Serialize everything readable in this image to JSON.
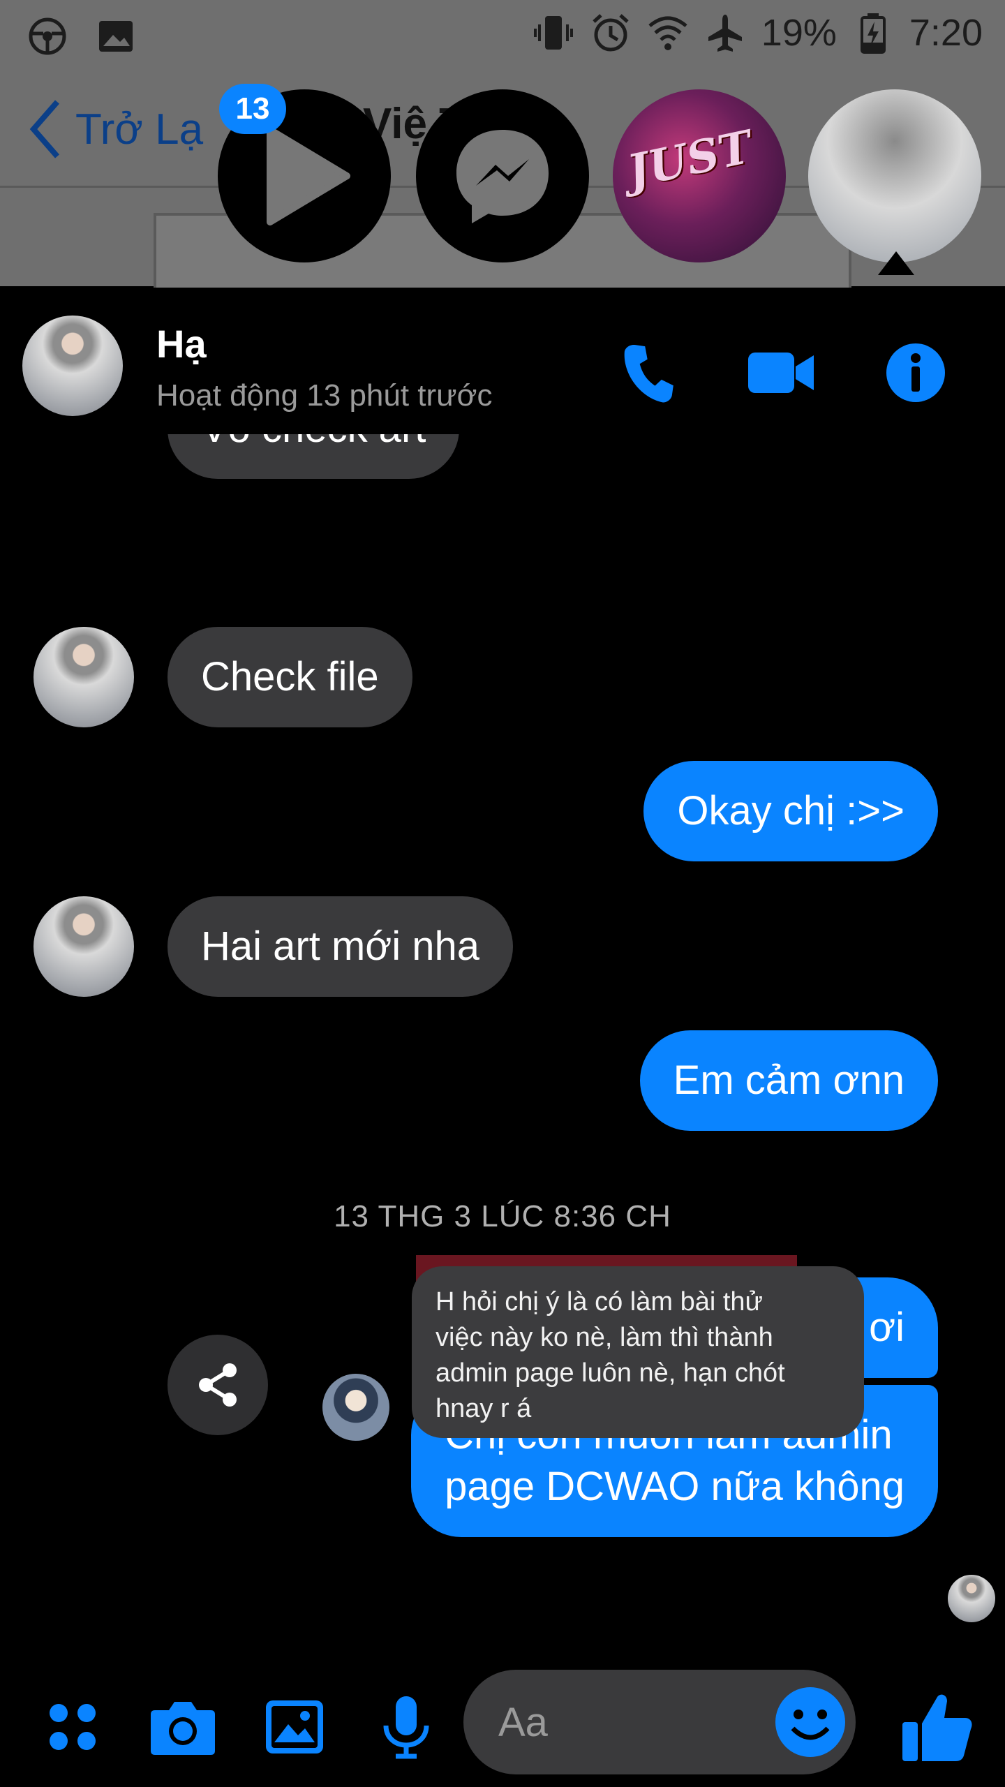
{
  "status_bar": {
    "battery": "19%",
    "time": "7:20",
    "icons": [
      "steering-wheel-icon",
      "image-icon",
      "vibrate-icon",
      "alarm-icon",
      "wifi-icon",
      "airplane-icon",
      "battery-charging-icon"
    ]
  },
  "background_app": {
    "back_label": "Trở Lạ",
    "title_partial": "Việ     Tôi"
  },
  "chat_heads": {
    "badge_count": "13",
    "cover_text": "JUST"
  },
  "chat": {
    "name": "Hạ",
    "status": "Hoạt động 13 phút trước",
    "messages": [
      {
        "side": "in",
        "text": "Vô check art"
      },
      {
        "side": "in",
        "text": "Check file"
      },
      {
        "side": "out",
        "text": "Okay chị :>>"
      },
      {
        "side": "in",
        "text": "Hai art mới nha"
      },
      {
        "side": "out",
        "text": "Em cảm ơnn"
      },
      {
        "side": "out",
        "text": "Chị ơi"
      },
      {
        "side": "out",
        "text": "Chị còn muốn làm admin\npage DCWAO nữa không"
      }
    ],
    "timestamp": "13 THG 3 LÚC 8:36 CH",
    "shared_image_text": "H hỏi chị ý là có làm bài thử\nviệc này ko nè, làm thì thành\nadmin page luôn nè, hạn chót\nhnay r á"
  },
  "composer": {
    "placeholder": "Aa"
  },
  "colors": {
    "accent": "#0a84ff",
    "incoming_bubble": "#3a3a3c",
    "background": "#000000"
  }
}
